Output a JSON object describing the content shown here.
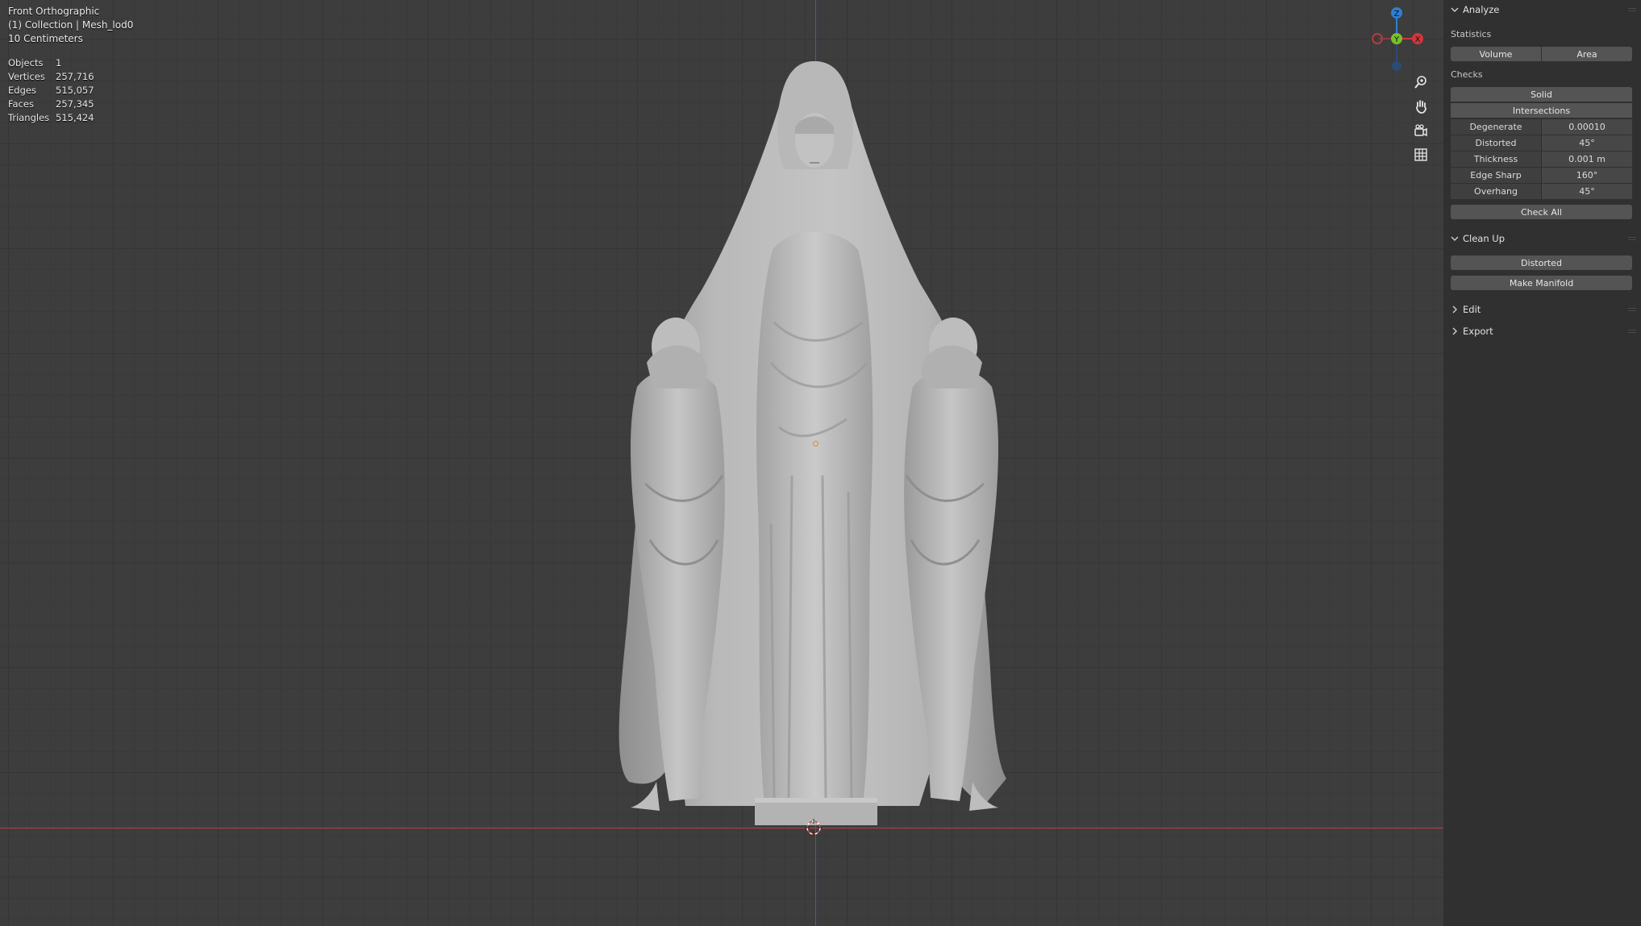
{
  "viewport": {
    "view_name": "Front Orthographic",
    "collection": "(1) Collection | Mesh_lod0",
    "scale": "10 Centimeters",
    "stats": [
      {
        "label": "Objects",
        "value": "1"
      },
      {
        "label": "Vertices",
        "value": "257,716"
      },
      {
        "label": "Edges",
        "value": "515,057"
      },
      {
        "label": "Faces",
        "value": "257,345"
      },
      {
        "label": "Triangles",
        "value": "515,424"
      }
    ],
    "gizmo": {
      "z": "Z",
      "y": "Y",
      "x": "X",
      "colors": {
        "x": "#d2363b",
        "y": "#7ac02a",
        "z": "#2f7fd6"
      }
    },
    "nav_icons": [
      "zoom-icon",
      "pan-hand-icon",
      "camera-view-icon",
      "grid-ortho-icon"
    ]
  },
  "panel": {
    "analyze": {
      "title": "Analyze",
      "statistics_label": "Statistics",
      "volume": "Volume",
      "area": "Area",
      "checks_label": "Checks",
      "solid": "Solid",
      "intersections": "Intersections",
      "checks": [
        {
          "name": "Degenerate",
          "value": "0.00010"
        },
        {
          "name": "Distorted",
          "value": "45°"
        },
        {
          "name": "Thickness",
          "value": "0.001 m"
        },
        {
          "name": "Edge Sharp",
          "value": "160°"
        },
        {
          "name": "Overhang",
          "value": "45°"
        }
      ],
      "check_all": "Check All"
    },
    "cleanup": {
      "title": "Clean Up",
      "distorted": "Distorted",
      "make_manifold": "Make Manifold"
    },
    "edit": {
      "title": "Edit"
    },
    "export": {
      "title": "Export"
    }
  }
}
